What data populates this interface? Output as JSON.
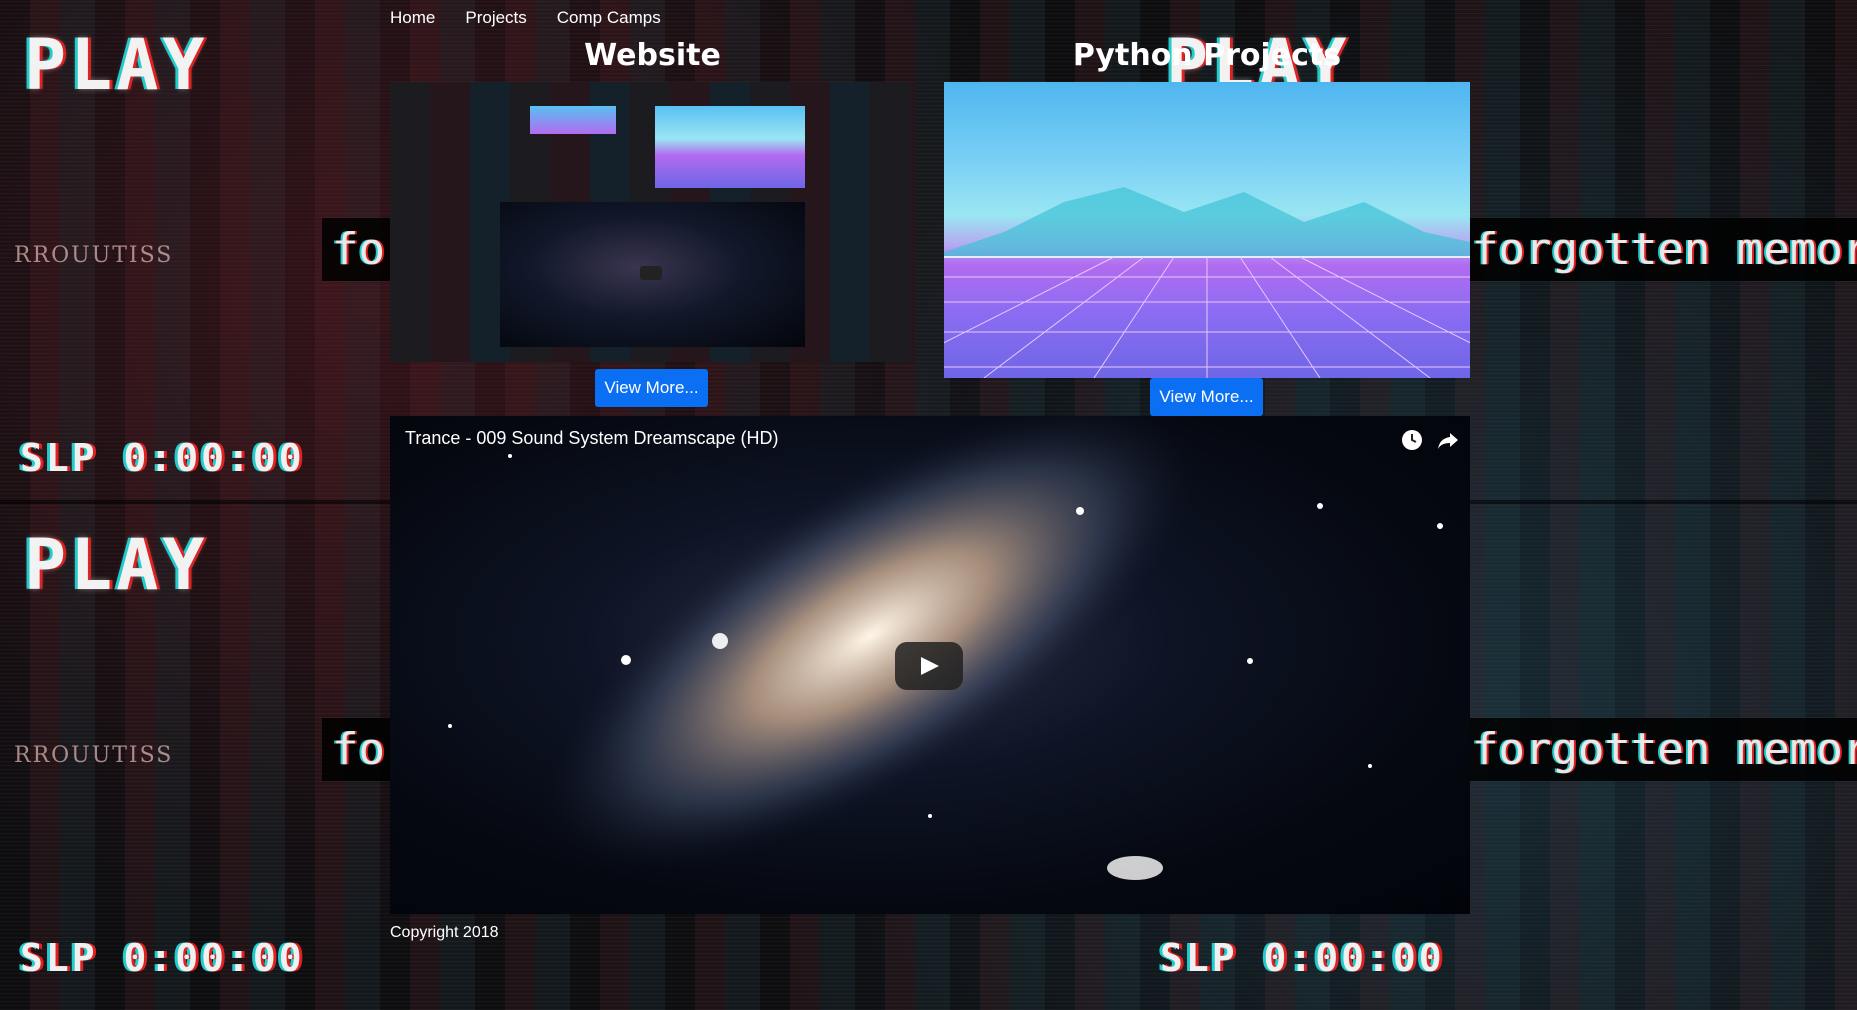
{
  "nav": {
    "items": [
      {
        "label": "Home"
      },
      {
        "label": "Projects"
      },
      {
        "label": "Comp Camps"
      }
    ]
  },
  "sections": {
    "website": {
      "title": "Website",
      "button_label": "View More..."
    },
    "python": {
      "title": "Python Projects",
      "button_label": "View More..."
    }
  },
  "background_text": {
    "play": "PLAY",
    "counter": "SLP 0:00:00",
    "forgotten": "forgotten memor",
    "rrou": "RROUUTISS"
  },
  "video": {
    "title": "Trance - 009 Sound System Dreamscape (HD)"
  },
  "footer": {
    "copyright": "Copyright 2018"
  },
  "colors": {
    "button": "#0a6ff2",
    "text": "#ffffff"
  },
  "icons": {
    "watch_later": "clock-icon",
    "share": "share-icon",
    "play": "play-icon"
  }
}
